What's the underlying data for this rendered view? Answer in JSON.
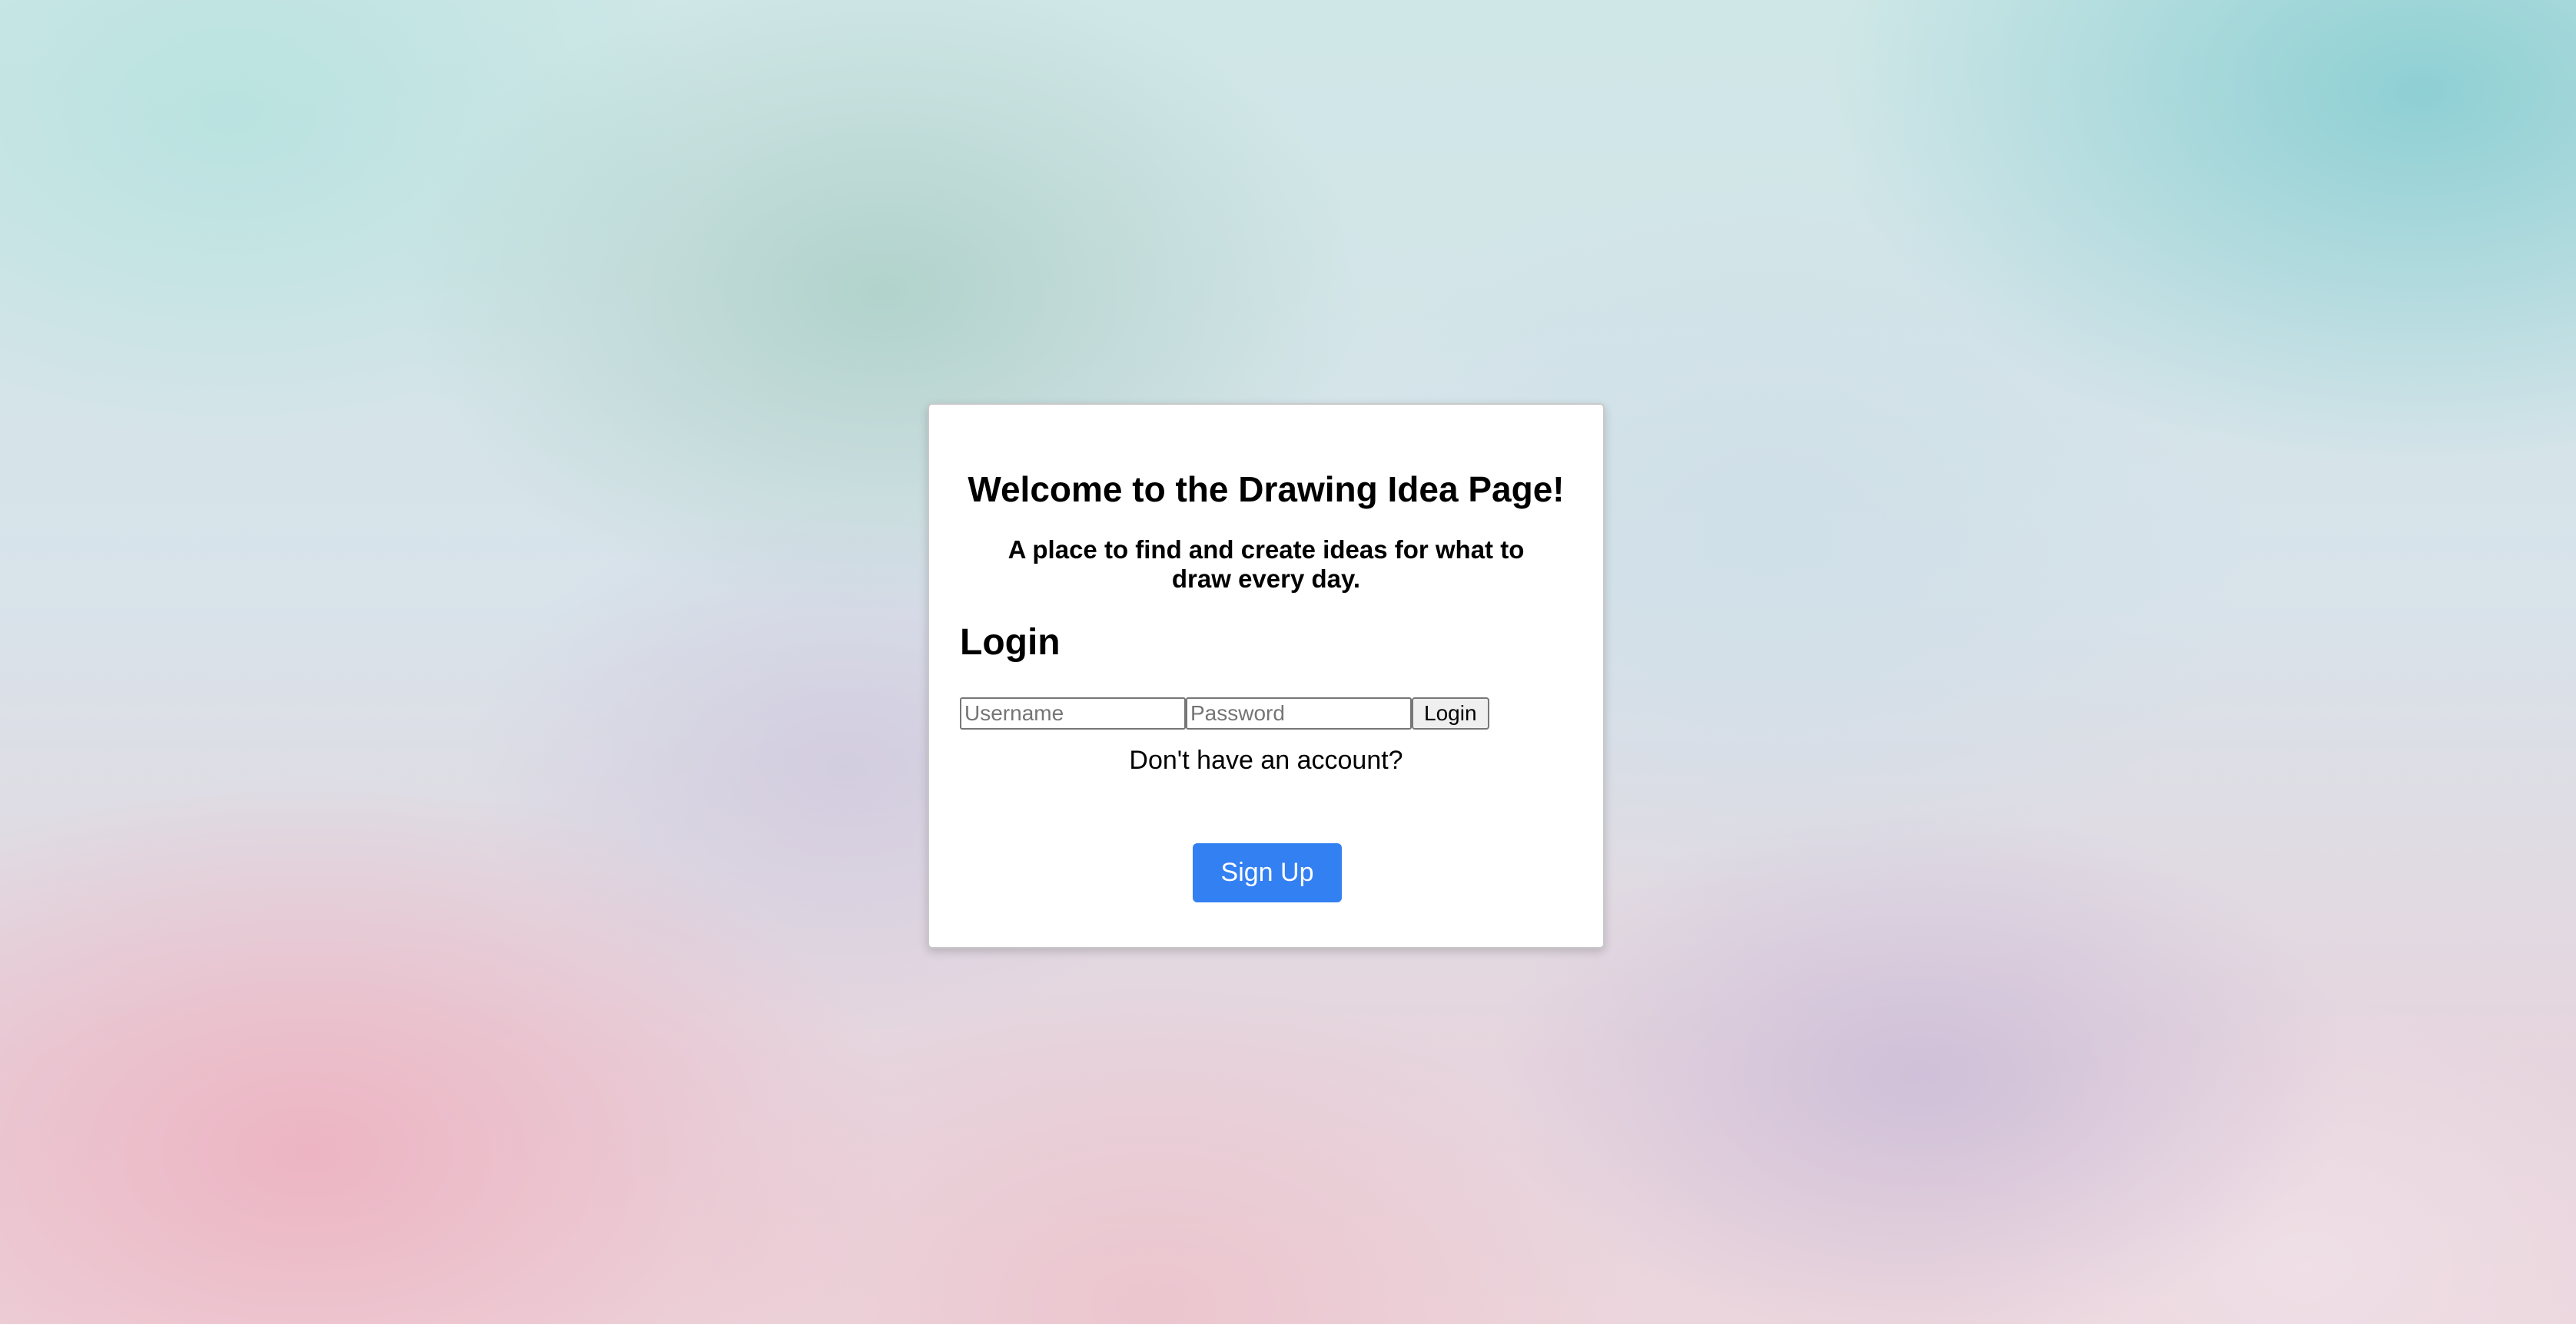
{
  "page": {
    "title": "Welcome to the Drawing Idea Page!",
    "subtitle": "A place to find and create ideas for what to draw every day."
  },
  "login": {
    "heading": "Login",
    "username_placeholder": "Username",
    "password_placeholder": "Password",
    "button_label": "Login"
  },
  "signup": {
    "prompt": "Don't have an account?",
    "button_label": "Sign Up"
  },
  "colors": {
    "accent": "#3380f2",
    "card_background": "#ffffff"
  }
}
